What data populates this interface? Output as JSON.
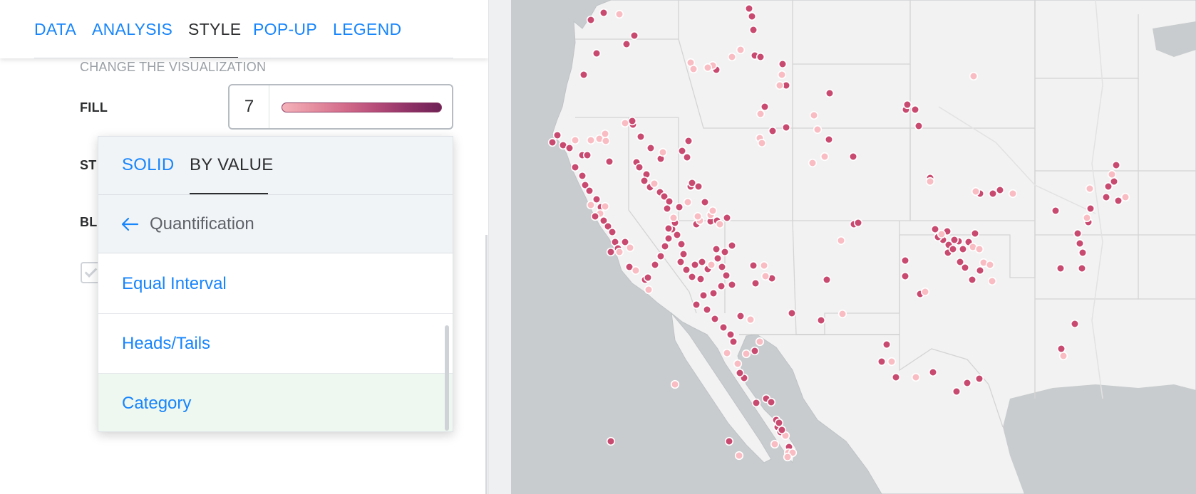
{
  "tabs": [
    {
      "label": "DATA",
      "active": false
    },
    {
      "label": "ANALYSIS",
      "active": false
    },
    {
      "label": "STYLE",
      "active": true
    },
    {
      "label": "POP-UP",
      "active": false
    },
    {
      "label": "LEGEND",
      "active": false
    }
  ],
  "style_panel": {
    "section_title": "CHANGE THE VISUALIZATION",
    "fill": {
      "label": "FILL",
      "value": "7",
      "ramp_icon": "color-ramp-pink-to-burgundy"
    },
    "stroke_label_partial": "ST",
    "blending_label_partial": "BL"
  },
  "dropdown": {
    "tabs": [
      {
        "label": "SOLID",
        "active": false
      },
      {
        "label": "BY VALUE",
        "active": true
      }
    ],
    "back": {
      "icon": "arrow-left-icon",
      "label": "Quantification"
    },
    "items": [
      {
        "label": "Equal Interval",
        "selected": false
      },
      {
        "label": "Heads/Tails",
        "selected": false
      },
      {
        "label": "Category",
        "selected": true
      }
    ]
  },
  "map": {
    "colors": {
      "land": "#f2f2f2",
      "water": "#c9ccce",
      "borders": "#d4d4d4",
      "point_dark": "#c94a70",
      "point_light": "#f9bcc2",
      "point_stroke": "#ffffff"
    },
    "theme": "light basemap with pink/burgundy point layer over western United States"
  },
  "colors": {
    "accent": "#1785fb",
    "text": "#2c2d2f",
    "muted": "#9aa0a6",
    "selected_bg": "#eef7f0"
  }
}
